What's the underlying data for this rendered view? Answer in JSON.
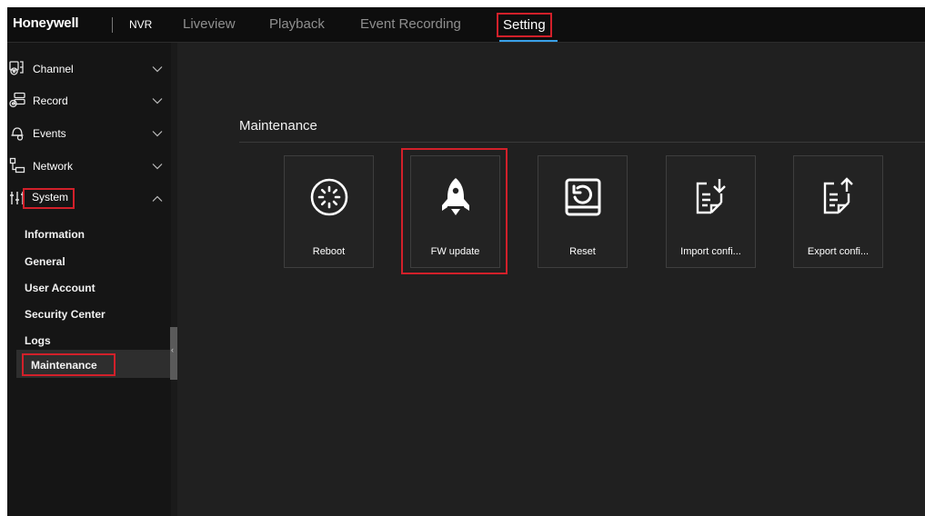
{
  "header": {
    "brand": "Honeywell",
    "product": "NVR",
    "tabs": [
      {
        "label": "Liveview",
        "active": false
      },
      {
        "label": "Playback",
        "active": false
      },
      {
        "label": "Event Recording",
        "active": false
      },
      {
        "label": "Setting",
        "active": true
      }
    ]
  },
  "sidebar": {
    "groups": [
      {
        "label": "Channel",
        "icon": "channel-icon",
        "expanded": false
      },
      {
        "label": "Record",
        "icon": "record-icon",
        "expanded": false
      },
      {
        "label": "Events",
        "icon": "events-icon",
        "expanded": false
      },
      {
        "label": "Network",
        "icon": "network-icon",
        "expanded": false
      },
      {
        "label": "System",
        "icon": "system-sliders-icon",
        "expanded": true
      }
    ],
    "system_items": [
      {
        "label": "Information",
        "selected": false
      },
      {
        "label": "General",
        "selected": false
      },
      {
        "label": "User Account",
        "selected": false
      },
      {
        "label": "Security Center",
        "selected": false
      },
      {
        "label": "Logs",
        "selected": false
      },
      {
        "label": "Maintenance",
        "selected": true
      }
    ]
  },
  "main": {
    "title": "Maintenance",
    "cards": [
      {
        "label": "Reboot",
        "icon": "reboot-icon"
      },
      {
        "label": "FW update",
        "icon": "rocket-icon"
      },
      {
        "label": "Reset",
        "icon": "reset-icon"
      },
      {
        "label": "Import confi...",
        "icon": "import-config-icon"
      },
      {
        "label": "Export confi...",
        "icon": "export-config-icon"
      }
    ]
  },
  "colors": {
    "highlight_border": "#d2202a",
    "active_tab_underline": "#3aa0e8",
    "background": "#202020",
    "topbar": "#0e0e0e",
    "sidebar": "#151515"
  }
}
